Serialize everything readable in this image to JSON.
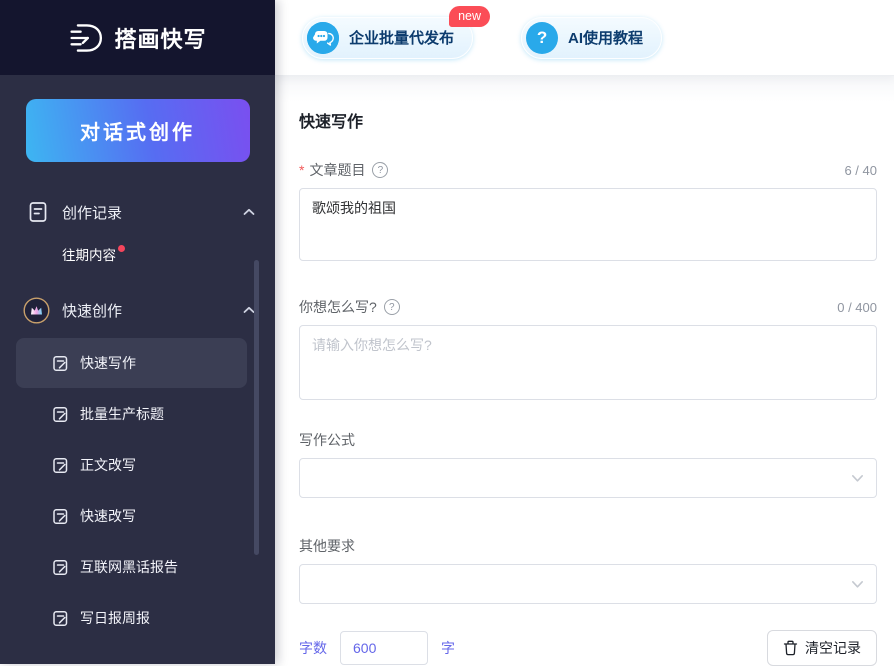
{
  "app": {
    "name": "搭画快写"
  },
  "colors": {
    "accent_purple": "#6466e9",
    "brand_blue": "#29a9ea",
    "badge_red": "#fb4d57",
    "required_red": "#f25a5a",
    "cta_gradient_start": "#3db6f2",
    "cta_gradient_end": "#7a4ff0",
    "topbar_bg": "#14152e",
    "sidebar_bg": "#2c2e44",
    "active_item_bg": "#3b3e54"
  },
  "icons": {
    "help_glyph": "?",
    "question_glyph": "?"
  },
  "header": {
    "enterprise_button": {
      "label": "企业批量代发布",
      "badge": "new"
    },
    "tutorial_button": {
      "label": "AI使用教程"
    }
  },
  "sidebar": {
    "cta_label": "对话式创作",
    "groups": [
      {
        "label": "创作记录",
        "children": [
          {
            "label": "往期内容",
            "has_new_dot": true
          }
        ]
      },
      {
        "label": "快速创作",
        "children": [
          {
            "label": "快速写作",
            "active": true
          },
          {
            "label": "批量生产标题"
          },
          {
            "label": "正文改写"
          },
          {
            "label": "快速改写"
          },
          {
            "label": "互联网黑话报告"
          },
          {
            "label": "写日报周报"
          }
        ]
      }
    ]
  },
  "main": {
    "title": "快速写作",
    "required_mark": "*",
    "article_title": {
      "label": "文章题目",
      "counter": "6 / 40",
      "value": "歌颂我的祖国"
    },
    "how_to_write": {
      "label": "你想怎么写?",
      "counter": "0 / 400",
      "placeholder": "请输入你想怎么写?",
      "value": ""
    },
    "formula": {
      "label": "写作公式",
      "value": ""
    },
    "other": {
      "label": "其他要求",
      "value": ""
    },
    "word_count": {
      "label": "字数",
      "value": "600",
      "unit": "字"
    },
    "clear_button_label": "清空记录"
  }
}
